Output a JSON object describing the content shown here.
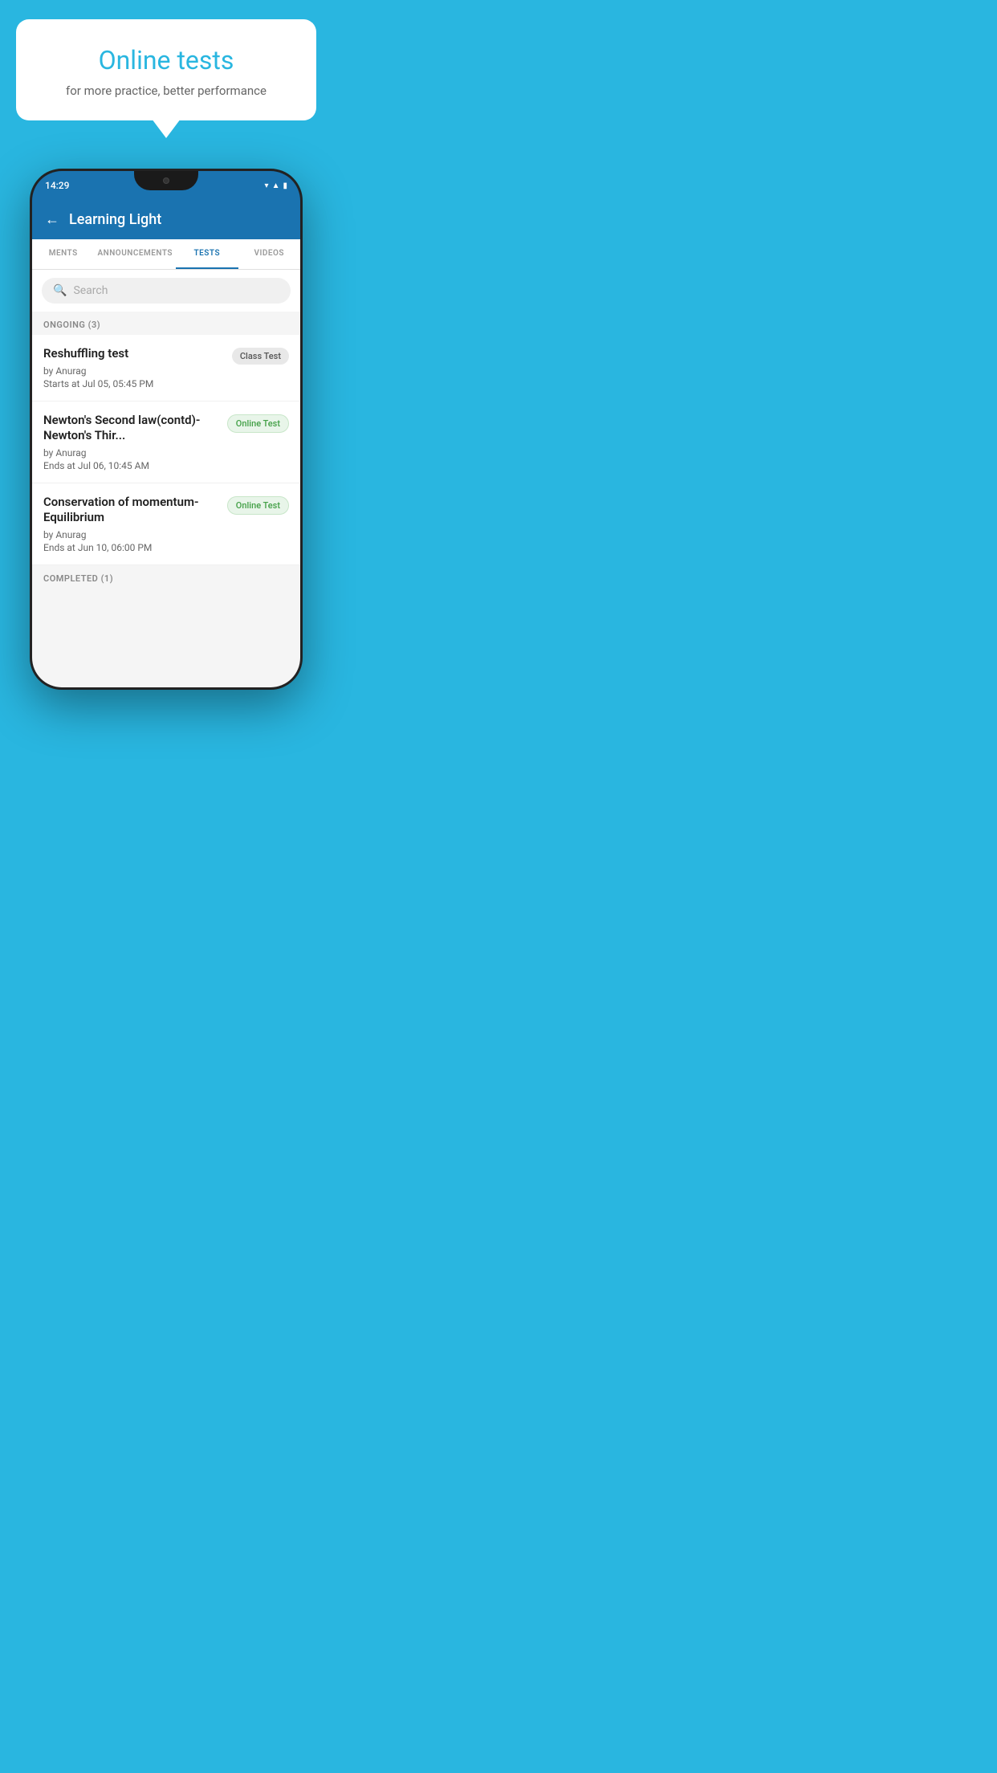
{
  "background_color": "#29b6e0",
  "speech_bubble": {
    "title": "Online tests",
    "subtitle": "for more practice, better performance"
  },
  "phone": {
    "status_bar": {
      "time": "14:29",
      "icons": [
        "wifi",
        "signal",
        "battery"
      ]
    },
    "header": {
      "back_label": "←",
      "title": "Learning Light"
    },
    "tabs": [
      {
        "label": "MENTS",
        "active": false
      },
      {
        "label": "ANNOUNCEMENTS",
        "active": false
      },
      {
        "label": "TESTS",
        "active": true
      },
      {
        "label": "VIDEOS",
        "active": false
      }
    ],
    "search": {
      "placeholder": "Search",
      "icon": "🔍"
    },
    "sections": [
      {
        "header": "ONGOING (3)",
        "items": [
          {
            "name": "Reshuffling test",
            "by": "by Anurag",
            "date_label": "Starts at",
            "date": "Jul 05, 05:45 PM",
            "badge": "Class Test",
            "badge_type": "class"
          },
          {
            "name": "Newton's Second law(contd)-Newton's Thir...",
            "by": "by Anurag",
            "date_label": "Ends at",
            "date": "Jul 06, 10:45 AM",
            "badge": "Online Test",
            "badge_type": "online"
          },
          {
            "name": "Conservation of momentum-Equilibrium",
            "by": "by Anurag",
            "date_label": "Ends at",
            "date": "Jun 10, 06:00 PM",
            "badge": "Online Test",
            "badge_type": "online"
          }
        ]
      }
    ],
    "completed_section_label": "COMPLETED (1)"
  }
}
